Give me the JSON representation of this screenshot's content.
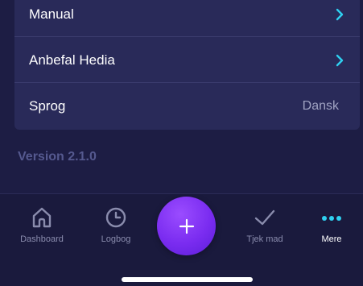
{
  "settings": {
    "items": [
      {
        "label": "Manual",
        "icon": "chevron-right-icon"
      },
      {
        "label": "Anbefal Hedia",
        "icon": "chevron-right-icon"
      },
      {
        "label": "Sprog",
        "value": "Dansk"
      }
    ],
    "version": "Version 2.1.0"
  },
  "tabbar": {
    "tabs": [
      {
        "label": "Dashboard",
        "icon": "home-icon"
      },
      {
        "label": "Logbog",
        "icon": "clock-icon"
      },
      {
        "label": "Tjek mad",
        "icon": "checkmark-icon"
      },
      {
        "label": "Mere",
        "icon": "more-dots-icon",
        "active": true
      }
    ],
    "fab_icon": "plus-icon"
  },
  "colors": {
    "background": "#1d1d44",
    "card": "#292a59",
    "accent": "#2fd0f0",
    "fab": "#8a3cf6",
    "version_text": "#55598f"
  }
}
